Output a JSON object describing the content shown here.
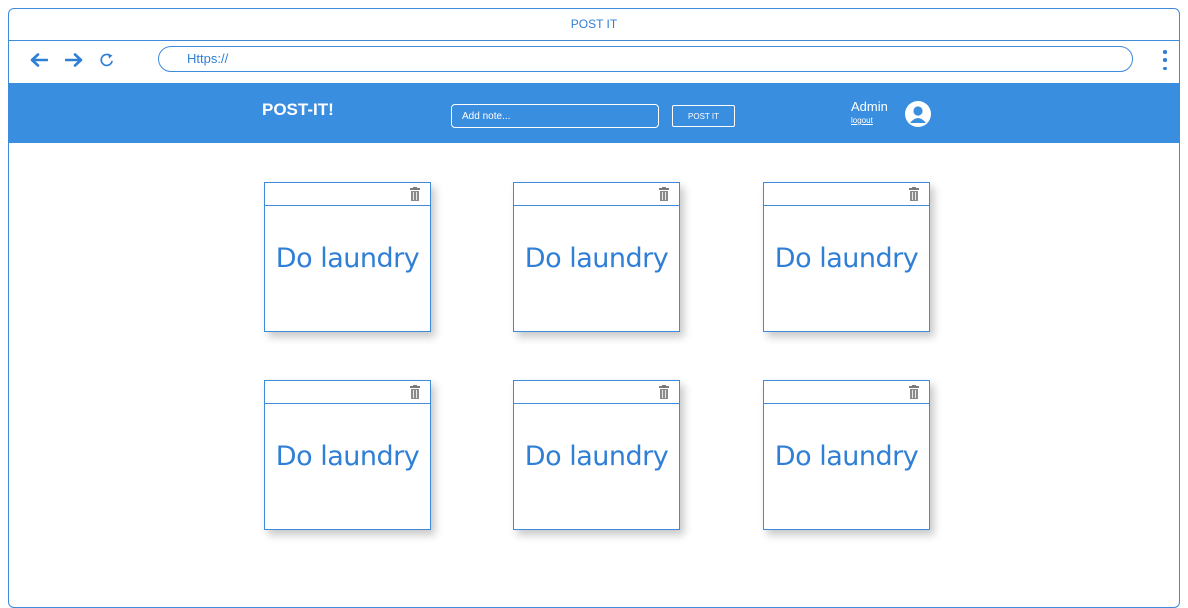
{
  "window": {
    "title": "POST IT",
    "url": "Https://"
  },
  "icons": {
    "back": "arrow-left-icon",
    "forward": "arrow-right-icon",
    "reload": "reload-icon",
    "menu": "kebab-menu-icon",
    "avatar": "user-avatar-icon",
    "delete": "trash-icon"
  },
  "colors": {
    "accent": "#3a8ee0",
    "text": "#2f7fd6"
  },
  "header": {
    "brand": "POST-IT!",
    "note_placeholder": "Add note...",
    "post_label": "POST IT",
    "user_name": "Admin",
    "logout_label": "logout"
  },
  "notes": [
    {
      "text": "Do laundry"
    },
    {
      "text": "Do laundry"
    },
    {
      "text": "Do laundry"
    },
    {
      "text": "Do laundry"
    },
    {
      "text": "Do laundry"
    },
    {
      "text": "Do laundry"
    }
  ]
}
